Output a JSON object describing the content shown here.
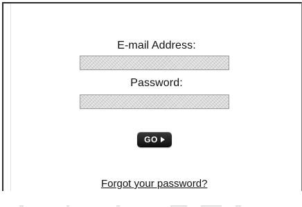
{
  "login_form": {
    "email_label": "E-mail Address:",
    "email_value": "",
    "password_label": "Password:",
    "password_value": "",
    "go_button_label": "GO",
    "go_button_icon": "arrow-right-icon",
    "forgot_password_link": "Forgot your password?"
  }
}
